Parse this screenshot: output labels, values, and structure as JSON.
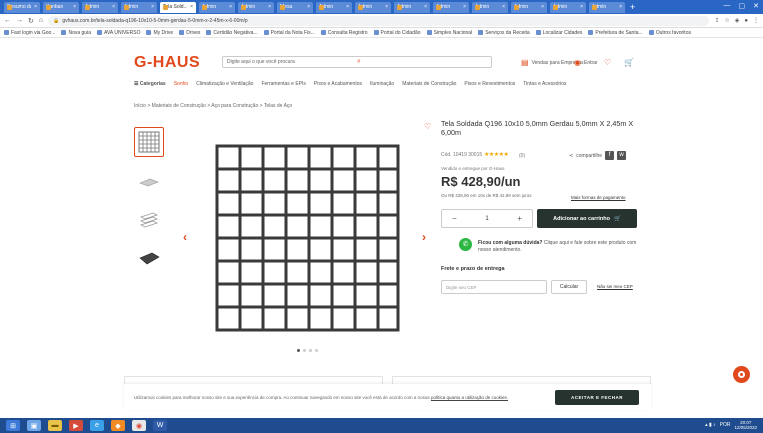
{
  "browser": {
    "tabs": [
      {
        "label": "Resumo da..."
      },
      {
        "label": "Kanban"
      },
      {
        "label": "Admin"
      },
      {
        "label": "Admin"
      },
      {
        "label": "Tela Sold...",
        "active": true
      },
      {
        "label": "Admin"
      },
      {
        "label": "Admin"
      },
      {
        "label": "Mesa"
      },
      {
        "label": "Admin"
      },
      {
        "label": "Admin"
      },
      {
        "label": "Admin"
      },
      {
        "label": "Admin"
      },
      {
        "label": "Admin"
      },
      {
        "label": "Admin"
      },
      {
        "label": "Admin"
      },
      {
        "label": "Admin"
      }
    ],
    "url": "gvhaus.com.br/tela-soldada-q196-10x10-5-0mm-gerdau-5-0mm-x-2-45m-x-6-00m/p",
    "bookmarks": [
      "Fast login via Goo...",
      "Nova guia",
      "AVA UNIVERSO",
      "My Drive",
      "Drives",
      "Certidão Negativa...",
      "Portal da Nota Fis...",
      "Consulta Registro",
      "Portal do Cidadão",
      "Simples Nacional",
      "Serviços da Receita",
      "Localizar Cidades",
      "Prefeitura de Santa...",
      "Outros favoritos"
    ]
  },
  "header": {
    "logo": "G-HAUS",
    "search_placeholder": "Digite aqui o que você procura",
    "links": [
      "Vendas para Empresas",
      "Entrar"
    ]
  },
  "nav": {
    "categories_label": "Categorias",
    "items": [
      "Sonho",
      "Climatização e Ventilação",
      "Ferramentas e EPIs",
      "Pisos e Acabamentos",
      "Iluminação",
      "Materiais de Construção",
      "Pisos e Revestimentos",
      "Tintas e Acessórios"
    ]
  },
  "breadcrumb": "Início > Materiais de Construção > Aço para Construção > Telas de Aço",
  "product": {
    "title": "Tela Soldada Q196 10x10 5,0mm Gerdau 5,0mm X 2,45m X 6,00m",
    "code": "Cód. 10419 30015",
    "rating_stars": "★★★★★",
    "review_count": "(0)",
    "share_label": "compartilhe",
    "sold_by": "Vendido e entregue por G-Haus",
    "price": "R$ 428,90/un",
    "installments": "Ou R$ 428,90 em 10x de R$ 42,89 sem juros",
    "payment_link": "Mais formas de pagamento",
    "qty_minus": "−",
    "qty_value": "1",
    "qty_plus": "+",
    "add_to_cart": "Adicionar ao carrinho",
    "help_title": "Ficou com alguma dúvida?",
    "help_text": "Clique aqui e fale sobre este produto com nosso atendimento.",
    "shipping_title": "Frete e prazo de entrega",
    "cep_placeholder": "Digite seu CEP",
    "calc_button": "Calcular",
    "no_cep_link": "Não sei meu CEP"
  },
  "cookie": {
    "text": "Utilizamos cookies para melhorar nosso site e sua experiência de compra. Ao continuar navegando em nosso site você está de acordo com a nossa",
    "link": "política quanto a utilização de cookies.",
    "accept": "ACEITAR E FECHAR"
  },
  "taskbar": {
    "tray_text": "POR",
    "clock_time": "20:07",
    "clock_date": "12/05/2022"
  },
  "colors": {
    "brand": "#e0491b",
    "button_dark": "#26332f",
    "whatsapp": "#2bb741",
    "stars": "#f2a900"
  }
}
